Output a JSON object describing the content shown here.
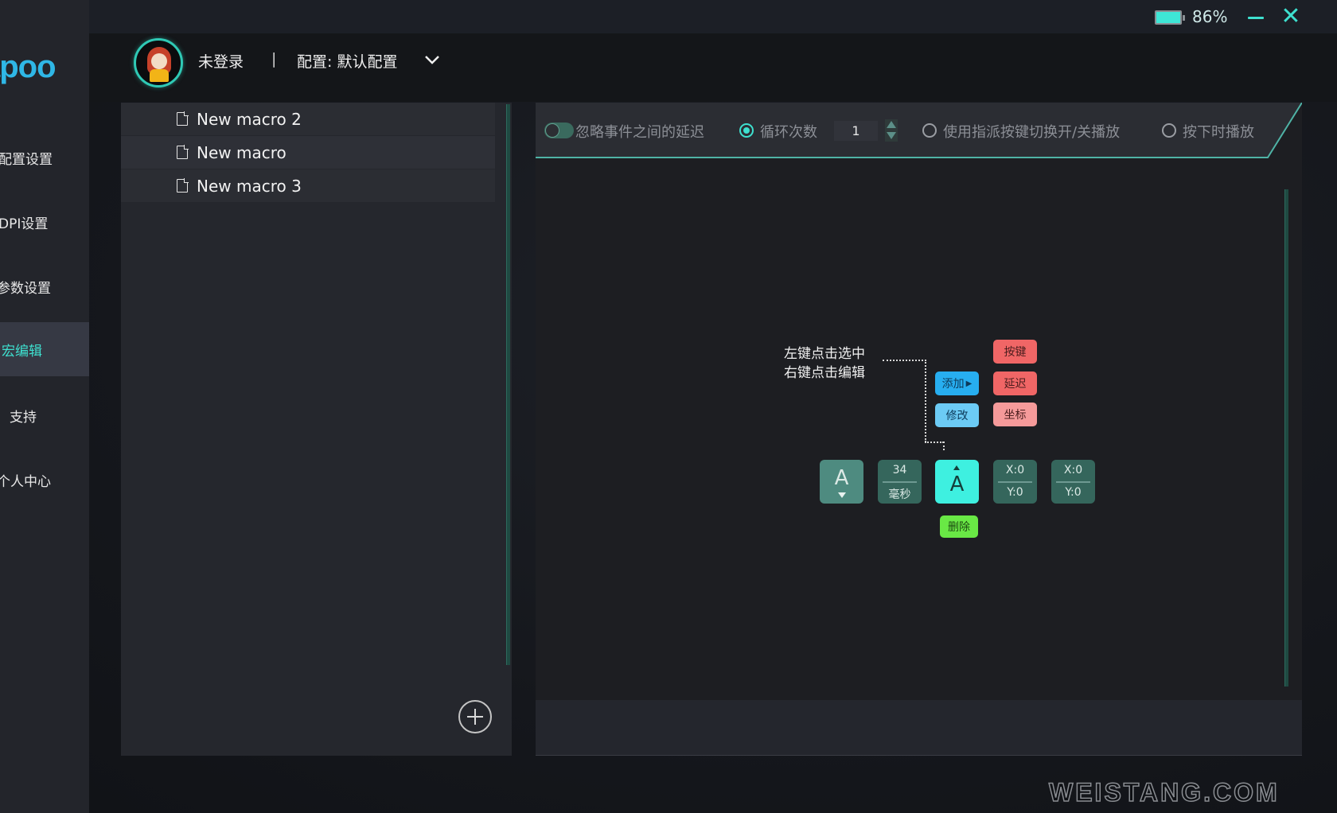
{
  "app": {
    "logo_text": "apoo",
    "battery": {
      "percent": 86,
      "label": "86%"
    },
    "window_controls": {
      "minimize": "minimize",
      "close": "✕"
    }
  },
  "sidebar": {
    "items": [
      {
        "label": "配置设置",
        "active": false
      },
      {
        "label": "DPI设置",
        "active": false
      },
      {
        "label": "参数设置",
        "active": false
      },
      {
        "label": "宏编辑",
        "active": true
      },
      {
        "label": "支持",
        "active": false
      },
      {
        "label": "个人中心",
        "active": false
      }
    ]
  },
  "header": {
    "login_status": "未登录",
    "separator": "|",
    "config_label": "配置: 默认配置"
  },
  "macro_list": {
    "items": [
      {
        "label": "New macro 2"
      },
      {
        "label": "New macro"
      },
      {
        "label": "New macro 3"
      }
    ],
    "add_button": "add-macro"
  },
  "options": {
    "ignore_delay": {
      "label": "忽略事件之间的延迟",
      "enabled": false
    },
    "loop_count": {
      "label": "循环次数",
      "selected": true,
      "value": "1"
    },
    "toggle_play": {
      "label": "使用指派按键切换开/关播放",
      "selected": false
    },
    "hold_play": {
      "label": "按下时播放",
      "selected": false
    }
  },
  "help_diagram": {
    "hint_line1": "左键点击选中",
    "hint_line2": "右键点击编辑",
    "menu": {
      "add": "添加",
      "modify": "修改",
      "key": "按键",
      "delay": "延迟",
      "coordinate": "坐标",
      "delete": "删除"
    },
    "events": [
      {
        "type": "key-down",
        "label": "A"
      },
      {
        "type": "delay",
        "value": "34",
        "unit": "毫秒"
      },
      {
        "type": "key-up",
        "label": "A"
      },
      {
        "type": "coordinate",
        "x": "X:0",
        "y": "Y:0"
      },
      {
        "type": "coordinate",
        "x": "X:0",
        "y": "Y:0"
      }
    ]
  },
  "colors": {
    "accent": "#3ee0cf",
    "logo": "#2fb7e6",
    "chip_red": "#f06666",
    "chip_blue": "#27aef0",
    "chip_green": "#69e845"
  },
  "watermark": "WEISTANG.COM"
}
